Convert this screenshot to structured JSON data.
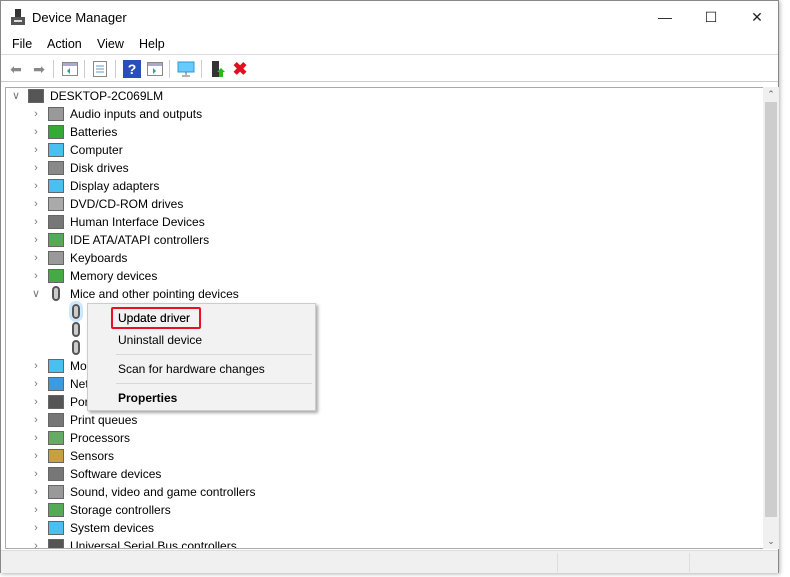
{
  "window": {
    "title": "Device Manager",
    "controls": [
      "minimize",
      "maximize",
      "close"
    ]
  },
  "menubar": [
    "File",
    "Action",
    "View",
    "Help"
  ],
  "toolbar": [
    "back-icon",
    "forward-icon",
    "show-hide-console-tree-icon",
    "properties-icon",
    "help-icon",
    "action-pane-icon",
    "scan-hardware-icon",
    "update-driver-icon",
    "uninstall-icon"
  ],
  "tree": {
    "root": "DESKTOP-2C069LM",
    "items": [
      {
        "label": "Audio inputs and outputs",
        "icon": "speaker"
      },
      {
        "label": "Batteries",
        "icon": "battery"
      },
      {
        "label": "Computer",
        "icon": "monitor"
      },
      {
        "label": "Disk drives",
        "icon": "disk"
      },
      {
        "label": "Display adapters",
        "icon": "monitor"
      },
      {
        "label": "DVD/CD-ROM drives",
        "icon": "dvd"
      },
      {
        "label": "Human Interface Devices",
        "icon": "hid"
      },
      {
        "label": "IDE ATA/ATAPI controllers",
        "icon": "ide"
      },
      {
        "label": "Keyboards",
        "icon": "keyboard"
      },
      {
        "label": "Memory devices",
        "icon": "memory"
      },
      {
        "label": "Mice and other pointing devices",
        "icon": "mouse",
        "expanded": true,
        "children": 3
      },
      {
        "label": "Mo",
        "icon": "monitor"
      },
      {
        "label": "Net",
        "icon": "network"
      },
      {
        "label": "Por",
        "icon": "port"
      },
      {
        "label": "Print queues",
        "icon": "printer"
      },
      {
        "label": "Processors",
        "icon": "cpu"
      },
      {
        "label": "Sensors",
        "icon": "sensor"
      },
      {
        "label": "Software devices",
        "icon": "software"
      },
      {
        "label": "Sound, video and game controllers",
        "icon": "speaker"
      },
      {
        "label": "Storage controllers",
        "icon": "storage"
      },
      {
        "label": "System devices",
        "icon": "monitor"
      },
      {
        "label": "Universal Serial Bus controllers",
        "icon": "usb"
      }
    ]
  },
  "context_menu": {
    "items": [
      "Update driver",
      "Uninstall device",
      "Scan for hardware changes",
      "Properties"
    ],
    "highlighted": "Update driver"
  },
  "colors": {
    "highlight_box": "#e81123",
    "selection": "#cce8ff"
  }
}
